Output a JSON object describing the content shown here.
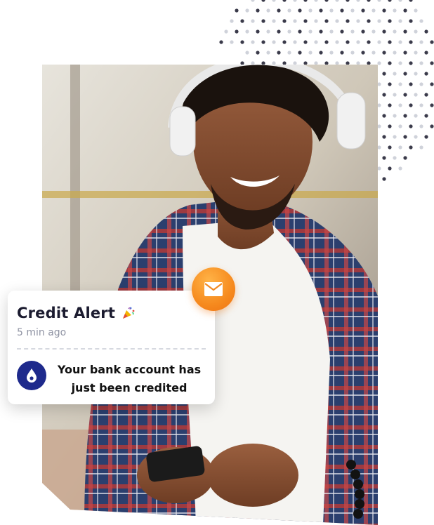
{
  "notification": {
    "title": "Credit Alert",
    "title_icon": "party-popper-icon",
    "time": "5 min ago",
    "message": "Your bank account has just been credited",
    "bank_icon": "drop-icon"
  },
  "badge": {
    "icon": "envelope-icon"
  },
  "photo": {
    "subject": ""
  },
  "colors": {
    "badge_orange": "#f68a1e",
    "bank_blue": "#1e2a8c",
    "dots_dark": "#3a3a4a",
    "dots_light": "#cfd2da"
  }
}
